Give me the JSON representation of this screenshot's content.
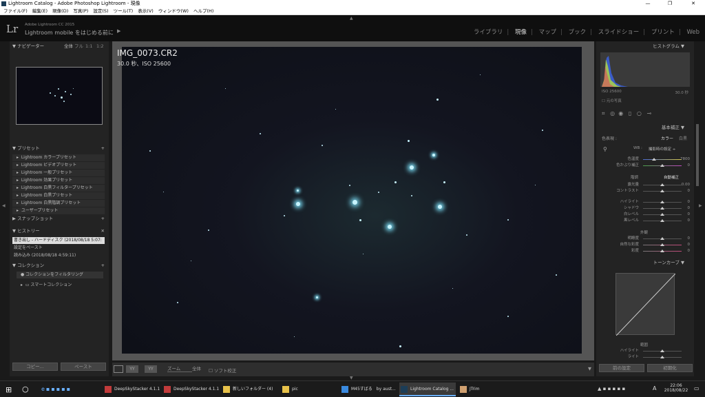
{
  "window": {
    "title": "Lightroom Catalog - Adobe Photoshop Lightroom - 現像"
  },
  "menu": [
    "ファイル(F)",
    "編集(E)",
    "現像(D)",
    "写真(P)",
    "設定(S)",
    "ツール(T)",
    "表示(V)",
    "ウィンドウ(W)",
    "ヘルプ(H)"
  ],
  "identity": {
    "logo": "Lr",
    "product": "Adobe Lightroom CC 2015",
    "mobile": "Lightroom mobile をはじめる前に"
  },
  "modules": [
    "ライブラリ",
    "現像",
    "マップ",
    "ブック",
    "スライドショー",
    "プリント",
    "Web"
  ],
  "left": {
    "navigator": {
      "title": "ナビゲーター",
      "zoom": [
        "全体",
        "フル",
        "1:1",
        "1:2"
      ]
    },
    "presets": {
      "title": "プリセット",
      "items": [
        "Lightroom カラープリセット",
        "Lightroom ビデオプリセット",
        "Lightroom 一般プリセット",
        "Lightroom 効果プリセット",
        "Lightroom 白黒フィルタープリセット",
        "Lightroom 白黒プリセット",
        "Lightroom 白黒階調プリセット",
        "ユーザープリセット"
      ]
    },
    "snapshots": {
      "title": "スナップショット"
    },
    "history": {
      "title": "ヒストリー",
      "items": [
        "書き出し - ハードディスク (2018/08/18 5:07:",
        "設定をペースト",
        "読み込み (2018/08/18 4:59:11)"
      ]
    },
    "collections": {
      "title": "コレクション",
      "filter": "コレクションをフィルタリング",
      "smart": "スマートコレクション"
    },
    "copy": "コピー...",
    "paste": "ペースト"
  },
  "photo": {
    "filename": "IMG_0073.CR2",
    "exposure": "30.0 秒、ISO 25600"
  },
  "toolbar": {
    "zoom_label": "ズーム",
    "zoom_value": "全体",
    "softproof": "ソフト校正"
  },
  "right": {
    "histogram": {
      "title": "ヒストグラム",
      "iso": "ISO 25600",
      "shutter": "30.0 秒",
      "original": "元の写真"
    },
    "basic": {
      "title": "基本補正",
      "treatment": "色表現 :",
      "color": "カラー",
      "bw": "白黒",
      "wb_label": "WB :",
      "wb_value": "撮影時の設定 ÷",
      "temp": {
        "label": "色温度",
        "value": "7800"
      },
      "tint": {
        "label": "色かぶり補正",
        "value": "0"
      },
      "tone": "階調",
      "auto": "自動補正",
      "exposure": {
        "label": "露光量",
        "value": "0.00"
      },
      "contrast": {
        "label": "コントラスト",
        "value": "0"
      },
      "highlights": {
        "label": "ハイライト",
        "value": "0"
      },
      "shadows": {
        "label": "シャドウ",
        "value": "0"
      },
      "whites": {
        "label": "白レベル",
        "value": "0"
      },
      "blacks": {
        "label": "黒レベル",
        "value": "0"
      },
      "presence": "外観",
      "clarity": {
        "label": "明瞭度",
        "value": "0"
      },
      "vibrance": {
        "label": "自然な彩度",
        "value": "0"
      },
      "saturation": {
        "label": "彩度",
        "value": "0"
      }
    },
    "tonecurve": {
      "title": "トーンカーブ",
      "region": "範囲",
      "highlights": "ハイライト",
      "lights": "ライト"
    },
    "prev": "前の設定",
    "reset": "初期化"
  },
  "taskbar": {
    "items": [
      "DeepSkyStacker 4.1.1",
      "DeepSkyStacker 4.1.1",
      "新しいフォルダー (4)",
      "pic",
      "M45すばる　by aust...",
      "Lightroom Catalog ...",
      "JTrim"
    ],
    "time": "22:06",
    "date": "2018/08/22",
    "ime": "A"
  },
  "colors": {
    "accent": "#c8f4ff",
    "panel": "#232323"
  }
}
